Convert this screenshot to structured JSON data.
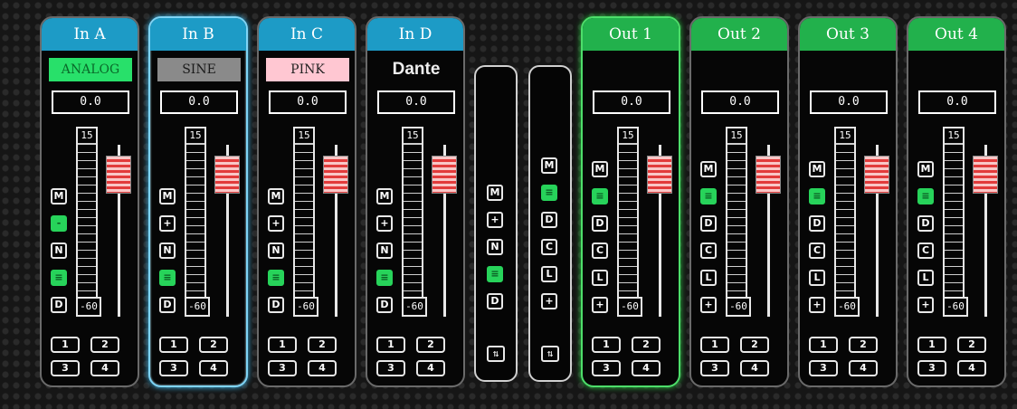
{
  "inputs": [
    {
      "label": "In A",
      "source": "ANALOG",
      "source_style": "analog",
      "gain": "0.0",
      "meter_top": "15",
      "meter_bottom": "-60",
      "buttons": [
        {
          "label": "M",
          "on": false
        },
        {
          "label": "-",
          "on": true
        },
        {
          "label": "N",
          "on": false
        },
        {
          "label": "≡",
          "on": true
        },
        {
          "label": "D",
          "on": false
        }
      ]
    },
    {
      "label": "In B",
      "source": "SINE",
      "source_style": "sine",
      "gain": "0.0",
      "meter_top": "15",
      "meter_bottom": "-60",
      "selected": true,
      "buttons": [
        {
          "label": "M",
          "on": false
        },
        {
          "label": "+",
          "on": false
        },
        {
          "label": "N",
          "on": false
        },
        {
          "label": "≡",
          "on": true
        },
        {
          "label": "D",
          "on": false
        }
      ]
    },
    {
      "label": "In C",
      "source": "PINK",
      "source_style": "pink",
      "gain": "0.0",
      "meter_top": "15",
      "meter_bottom": "-60",
      "buttons": [
        {
          "label": "M",
          "on": false
        },
        {
          "label": "+",
          "on": false
        },
        {
          "label": "N",
          "on": false
        },
        {
          "label": "≡",
          "on": true
        },
        {
          "label": "D",
          "on": false
        }
      ]
    },
    {
      "label": "In D",
      "source": "Dante",
      "source_style": "dante",
      "gain": "0.0",
      "meter_top": "15",
      "meter_bottom": "-60",
      "buttons": [
        {
          "label": "M",
          "on": false
        },
        {
          "label": "+",
          "on": false
        },
        {
          "label": "N",
          "on": false
        },
        {
          "label": "≡",
          "on": true
        },
        {
          "label": "D",
          "on": false
        }
      ]
    }
  ],
  "outputs": [
    {
      "label": "Out 1",
      "gain": "0.0",
      "meter_top": "15",
      "meter_bottom": "-60",
      "selected": true,
      "buttons": [
        {
          "label": "M",
          "on": false
        },
        {
          "label": "≡",
          "on": true
        },
        {
          "label": "D",
          "on": false
        },
        {
          "label": "C",
          "on": false
        },
        {
          "label": "L",
          "on": false
        },
        {
          "label": "+",
          "on": false
        }
      ]
    },
    {
      "label": "Out 2",
      "gain": "0.0",
      "meter_top": "15",
      "meter_bottom": "-60",
      "buttons": [
        {
          "label": "M",
          "on": false
        },
        {
          "label": "≡",
          "on": true
        },
        {
          "label": "D",
          "on": false
        },
        {
          "label": "C",
          "on": false
        },
        {
          "label": "L",
          "on": false
        },
        {
          "label": "+",
          "on": false
        }
      ]
    },
    {
      "label": "Out 3",
      "gain": "0.0",
      "meter_top": "15",
      "meter_bottom": "-60",
      "buttons": [
        {
          "label": "M",
          "on": false
        },
        {
          "label": "≡",
          "on": true
        },
        {
          "label": "D",
          "on": false
        },
        {
          "label": "C",
          "on": false
        },
        {
          "label": "L",
          "on": false
        },
        {
          "label": "+",
          "on": false
        }
      ]
    },
    {
      "label": "Out 4",
      "gain": "0.0",
      "meter_top": "15",
      "meter_bottom": "-60",
      "buttons": [
        {
          "label": "M",
          "on": false
        },
        {
          "label": "≡",
          "on": true
        },
        {
          "label": "D",
          "on": false
        },
        {
          "label": "C",
          "on": false
        },
        {
          "label": "L",
          "on": false
        },
        {
          "label": "+",
          "on": false
        }
      ]
    }
  ],
  "route_buttons": [
    "1",
    "2",
    "3",
    "4"
  ],
  "input_group": {
    "buttons": [
      {
        "label": "M",
        "on": false
      },
      {
        "label": "+",
        "on": false
      },
      {
        "label": "N",
        "on": false
      },
      {
        "label": "≡",
        "on": true
      },
      {
        "label": "D",
        "on": false
      }
    ],
    "link_icon": "link-icon"
  },
  "output_group": {
    "buttons": [
      {
        "label": "M",
        "on": false
      },
      {
        "label": "≡",
        "on": true
      },
      {
        "label": "D",
        "on": false
      },
      {
        "label": "C",
        "on": false
      },
      {
        "label": "L",
        "on": false
      },
      {
        "label": "+",
        "on": false
      }
    ],
    "link_icon": "link-icon"
  },
  "colors": {
    "input_header": "#1d9bc6",
    "output_header": "#22b14c",
    "button_on": "#27d35a",
    "fader_knob": "#e23b3b"
  }
}
